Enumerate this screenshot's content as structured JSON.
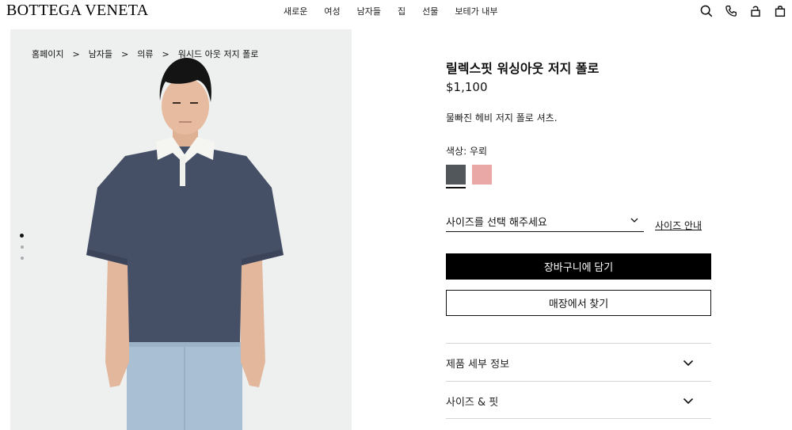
{
  "header": {
    "logo": "BOTTEGA VENETA",
    "nav": [
      "새로운",
      "여성",
      "남자들",
      "집",
      "선물",
      "보테가 내부"
    ],
    "icons": [
      "search-icon",
      "phone-icon",
      "account-icon",
      "bag-icon"
    ]
  },
  "breadcrumb": [
    "홈페이지",
    "남자들",
    "의류",
    "워시드 아웃 저지 폴로"
  ],
  "breadcrumb_separator": ">",
  "gallery": {
    "image_count": 3,
    "active_index": 0
  },
  "product": {
    "title": "릴렉스핏 워싱아웃 저지 폴로",
    "price": "$1,100",
    "description": "물빠진 헤비 저지 폴로 셔츠.",
    "color_label": "색상: 우뢰",
    "swatches": [
      {
        "name": "우뢰",
        "color": "#52575b",
        "selected": true
      },
      {
        "name": "pink",
        "color": "#e9a7a5",
        "selected": false
      }
    ],
    "size_select_label": "사이즈를 선택 해주세요",
    "size_guide": "사이즈 안내",
    "add_to_cart": "장바구니에 담기",
    "find_in_store": "매장에서 찾기",
    "accordion": [
      "제품 세부 정보",
      "사이즈 & 핏"
    ]
  },
  "colors": {
    "image_bg": "#eef0ef",
    "polo": "#454f66",
    "collar": "#f5f5f2",
    "jeans": "#a9bfd3",
    "button_primary": "#000000"
  }
}
